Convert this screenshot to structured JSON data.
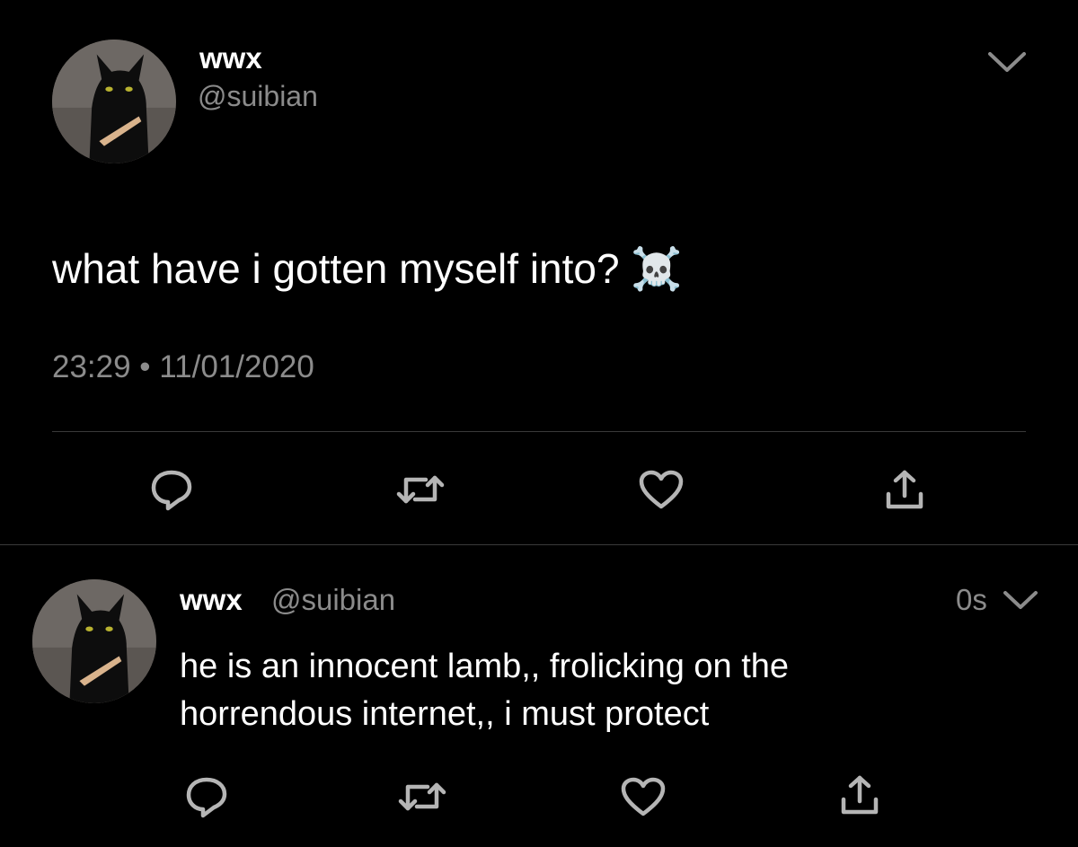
{
  "main_tweet": {
    "display_name": "wwx",
    "handle": "@suibian",
    "text": "what have i gotten myself into? ☠️",
    "timestamp": "23:29 • 11/01/2020",
    "avatar_icon": "black-cat-avatar"
  },
  "reply_tweet": {
    "display_name": "wwx",
    "handle": "@suibian",
    "age": "0s",
    "text_line1": "he is an innocent lamb,, frolicking on the",
    "text_line2": "horrendous internet,, i must protect",
    "avatar_icon": "black-cat-avatar"
  },
  "actions": [
    "reply-icon",
    "retweet-icon",
    "like-icon",
    "share-icon"
  ],
  "colors": {
    "background": "#000000",
    "text": "#ffffff",
    "muted": "#8b8b8b",
    "divider": "#3a3a3a"
  }
}
